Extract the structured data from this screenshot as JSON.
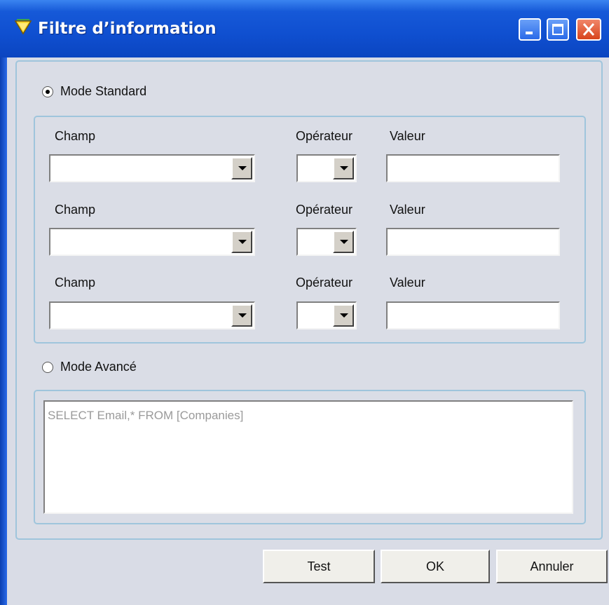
{
  "window": {
    "title": "Filtre d’information"
  },
  "standard": {
    "label": "Mode Standard",
    "selected": true,
    "rows": [
      {
        "field_label": "Champ",
        "operator_label": "Opérateur",
        "value_label": "Valeur",
        "field": "",
        "operator": "",
        "value": ""
      },
      {
        "field_label": "Champ",
        "operator_label": "Opérateur",
        "value_label": "Valeur",
        "field": "",
        "operator": "",
        "value": ""
      },
      {
        "field_label": "Champ",
        "operator_label": "Opérateur",
        "value_label": "Valeur",
        "field": "",
        "operator": "",
        "value": ""
      }
    ]
  },
  "advanced": {
    "label": "Mode Avancé",
    "selected": false,
    "query": "SELECT Email,* FROM [Companies]"
  },
  "buttons": {
    "test": "Test",
    "ok": "OK",
    "cancel": "Annuler"
  }
}
